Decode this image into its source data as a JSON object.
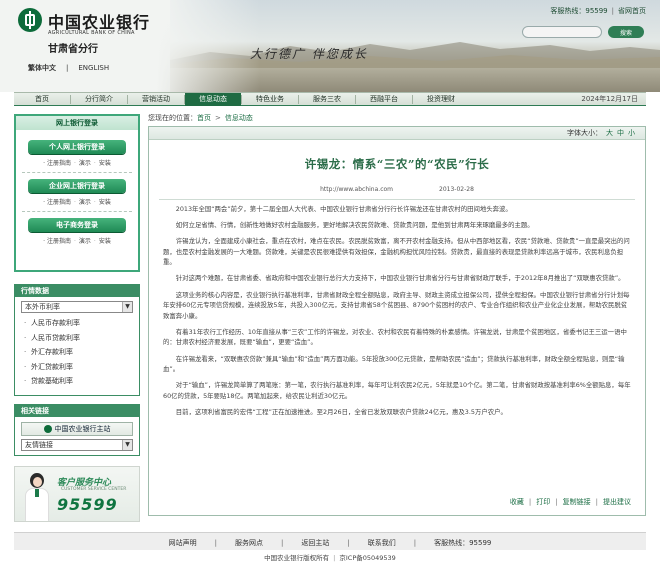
{
  "header": {
    "brand_cn": "中国农业银行",
    "brand_en": "AGRICULTURAL BANK OF CHINA",
    "branch": "甘肃省分行",
    "lang_cn": "繁体中文",
    "lang_en": "ENGLISH",
    "slogan": "大行德广  伴您成长",
    "hotline_label": "客服热线：95599",
    "home_link": "省网首页",
    "search_button": "搜索",
    "search_placeholder": ""
  },
  "nav": {
    "items": [
      "首页",
      "分行简介",
      "营销活动",
      "信息动态",
      "特色业务",
      "服务三农",
      "西融平台",
      "投资理财"
    ],
    "active": "信息动态",
    "date": "2024年12月17日"
  },
  "left": {
    "login_box_title": "网上银行登录",
    "personal_login": "个人网上银行登录",
    "corporate_login": "企业网上银行登录",
    "ecommerce_login": "电子商务登录",
    "sub_links": [
      "注册指南",
      "演示",
      "安装"
    ],
    "rates_title": "行情数据",
    "rates_select": "本外币利率",
    "rates_items": [
      "人民币存款利率",
      "人民币贷款利率",
      "外汇存款利率",
      "外汇贷款利率",
      "贷款基础利率"
    ],
    "related_title": "相关链接",
    "abc_link": "中国农业银行主站",
    "friend_select": "友情链接",
    "service_cn": "客户服务中心",
    "service_en": "CUSTOMER SERVICE CENTER",
    "service_number": "95599"
  },
  "breadcrumb": {
    "label": "您现在的位置：",
    "home": "首页",
    "arrow": ">",
    "current": "信息动态"
  },
  "article": {
    "font_size_label": "字体大小：",
    "font_sizes": [
      "大",
      "中",
      "小"
    ],
    "title": "许锡龙：情系“三农”的“农民”行长",
    "source": "http://www.abchina.com",
    "date": "2013-02-28",
    "paragraphs": [
      "2013年全国“两会”前夕，第十二届全国人大代表、中国农业银行甘肃省分行行长许锡龙还在甘肃农村的田间地头奔波。",
      "如何立足省情、行情，创新性地做好农村金融服务，更好地解决农民贷款难、贷款贵问题，是他到甘肃两年来琢磨最多的主题。",
      "许锡龙认为，全面建成小康社会，重点在农村，难点在农民。农民脱贫致富，离不开农村金融支持。但从中西部地区看，农民“贷款难、贷款贵”一直是最突出的问题，也是农村金融发展的一大难题。贷款难，关键是农民很难提供有效担保，金融机构担忧风险控制。贷款贵，最直接的表现是贷款利率远高于城市，农民利息负担重。",
      "针对这两个难题，在甘肃省委、省政府和中国农业银行总行大力支持下，中国农业银行甘肃省分行与甘肃省财政厅联手，于2012年8月推出了“双联惠农贷款”。",
      "这项业务的核心内容是，农业银行执行基准利率，甘肃省财政全程全额贴息，政府主导、财政主资成立担保公司，提供全程担保。中国农业银行甘肃省分行计划每年安排60亿元专项信贷规模，连续投放5年，共投入300亿元，支持甘肃省58个贫困县、8790个贫困村的农户、专业合作组织和农业产业化企业发展，帮助农民脱贫致富奔小康。",
      "有着31年农行工作经历、10年直接从事“三农”工作的许锡龙，对农业、农村和农民有着特殊的朴素感情。许锡龙说，甘肃是个贫困地区，省委书记王三运一语中的：甘肃农村经济要发展，既要“输血”，更要“造血”。",
      "在许锡龙看来，“双联惠农贷款”兼具“输血”和“造血”两方面功能。5年投放300亿元贷款，是帮助农民“造血”；贷款执行基准利率，财政全额全程贴息，则是“输血”。",
      "对于“输血”，许锡龙简单算了两笔账：第一笔，农行执行基准利率，每年可让利农民2亿元，5年就是10个亿。第二笔，甘肃省财政按基准利率6%全额贴息，每年60亿的贷款，5年要贴18亿。两笔加起来，给农民让利近30亿元。",
      "目前，这项利省富民的宏伟“工程”正在加速推进。至2月26日，全省已发放双联农户贷款24亿元，惠及3.5万户农户。"
    ],
    "actions": [
      "收藏",
      "打印",
      "复制链接",
      "提出建议"
    ]
  },
  "footer": {
    "links": [
      "网站声明",
      "服务网点",
      "返回主站",
      "联系我们",
      "客服热线：95599"
    ],
    "copyright": "中国农业银行版权所有",
    "icp": "京ICP备05049539"
  },
  "colors": {
    "brand_green": "#1f6b43",
    "accent_green": "#3ea77a",
    "title_green": "#2b6c49"
  }
}
